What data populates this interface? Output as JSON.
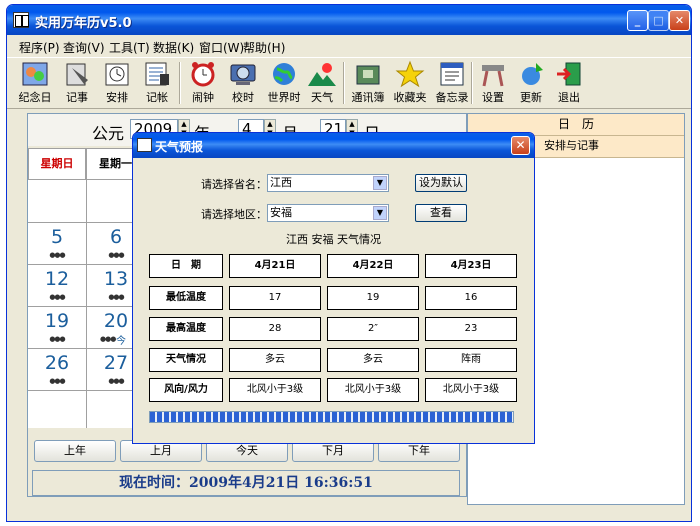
{
  "app": {
    "title": "实用万年历v5.0"
  },
  "menu": [
    "程序(P)",
    "查询(V)",
    "工具(T)",
    "数据(K)",
    "窗口(W)",
    "帮助(H)"
  ],
  "toolbar": [
    {
      "label": "纪念日",
      "icon": "memorial-icon"
    },
    {
      "label": "记事",
      "icon": "notes-icon"
    },
    {
      "label": "安排",
      "icon": "schedule-icon"
    },
    {
      "label": "记帐",
      "icon": "ledger-icon"
    },
    {
      "label": "闹钟",
      "icon": "alarm-clock-icon"
    },
    {
      "label": "校时",
      "icon": "time-sync-icon"
    },
    {
      "label": "世界时",
      "icon": "world-time-icon"
    },
    {
      "label": "天气",
      "icon": "weather-icon"
    },
    {
      "label": "通讯簿",
      "icon": "address-book-icon"
    },
    {
      "label": "收藏夹",
      "icon": "favorites-icon"
    },
    {
      "label": "备忘录",
      "icon": "memo-icon"
    },
    {
      "label": "设置",
      "icon": "settings-icon"
    },
    {
      "label": "更新",
      "icon": "update-icon"
    },
    {
      "label": "退出",
      "icon": "exit-icon"
    }
  ],
  "calendar": {
    "prefix": "公元",
    "year": "2009",
    "year_unit": "年",
    "month": "4",
    "month_unit": "月",
    "day": "21",
    "day_unit": "日",
    "headers": [
      "星期日",
      "星期一"
    ],
    "days": [
      "5",
      "6",
      "12",
      "13",
      "19",
      "20",
      "26",
      "27"
    ],
    "note_fragment": "今",
    "nav_buttons": [
      "上年",
      "上月",
      "今天",
      "下月",
      "下年"
    ],
    "now_time": "现在时间：2009年4月21日  16:36:51"
  },
  "right_panel": {
    "header": "日　历",
    "subheader": "安排与记事"
  },
  "dialog": {
    "title": "天气预报",
    "province_label": "请选择省名：",
    "province_value": "江西",
    "area_label": "请选择地区：",
    "area_value": "安福",
    "set_default_button": "设为默认",
    "view_button": "查看",
    "situation_title": "江西 安福 天气情况",
    "table": {
      "row_labels": [
        "日　期",
        "最低温度",
        "最高温度",
        "天气情况",
        "风向/风力"
      ],
      "columns": [
        {
          "date": "4月21日",
          "low": "17",
          "high": "28",
          "weather": "多云",
          "wind": "北风小于3级"
        },
        {
          "date": "4月22日",
          "low": "19",
          "high": "2″",
          "weather": "多云",
          "wind": "北风小于3级"
        },
        {
          "date": "4月23日",
          "low": "16",
          "high": "23",
          "weather": "阵雨",
          "wind": "北风小于3级"
        }
      ]
    },
    "progress": 1.0
  },
  "colors": {
    "titlebar": "#0058ee",
    "weekend": "#cc0000",
    "day_number": "#1b5e9c",
    "panel_header": "#fde9c8"
  }
}
